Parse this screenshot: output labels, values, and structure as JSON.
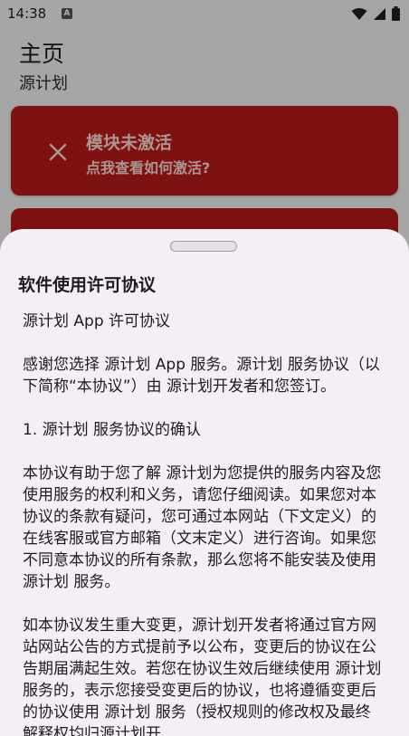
{
  "status_bar": {
    "time": "14:38",
    "notification_icon": "a-icon",
    "icons": [
      "wifi-icon",
      "signal-icon",
      "battery-icon"
    ]
  },
  "header": {
    "title": "主页",
    "subtitle": "源计划"
  },
  "module_card": {
    "title": "模块未激活",
    "subtitle": "点我查看如何激活?",
    "icon": "close-icon",
    "color": "#ba1a1a"
  },
  "sheet": {
    "title": "软件使用许可协议",
    "paragraphs": [
      "源计划 App 许可协议",
      "感谢您选择 源计划 App 服务。源计划 服务协议（以下简称“本协议”）由 源计划开发者和您签订。",
      "1. 源计划 服务协议的确认",
      "本协议有助于您了解 源计划为您提供的服务内容及您使用服务的权利和义务，请您仔细阅读。如果您对本协议的条款有疑问，您可通过本网站（下文定义）的在线客服或官方邮箱（文末定义）进行咨询。如果您不同意本协议的所有条款，那么您将不能安装及使用 源计划 服务。",
      "如本协议发生重大变更，源计划开发者将通过官方网站网站公告的方式提前予以公布，变更后的协议在公告期届满起生效。若您在协议生效后继续使用 源计划 服务的，表示您接受变更后的协议，也将遵循变更后的协议使用 源计划 服务（授权规则的修改权及最终解释权均归源计划开"
    ]
  }
}
